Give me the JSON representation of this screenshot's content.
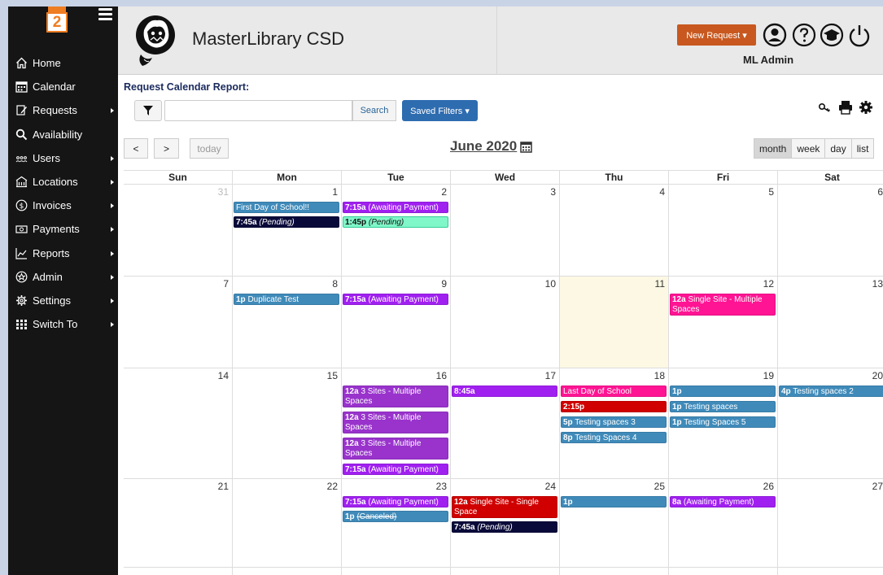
{
  "app": {
    "title": "MasterLibrary CSD",
    "new_request_label": "New Request ▾",
    "user_name": "ML Admin",
    "logo_text": "2"
  },
  "sidebar": {
    "items": [
      {
        "label": "Home",
        "icon": "home-icon",
        "arrow": false
      },
      {
        "label": "Calendar",
        "icon": "calendar-icon",
        "arrow": false
      },
      {
        "label": "Requests",
        "icon": "requests-icon",
        "arrow": true
      },
      {
        "label": "Availability",
        "icon": "search-icon",
        "arrow": false
      },
      {
        "label": "Users",
        "icon": "users-icon",
        "arrow": true
      },
      {
        "label": "Locations",
        "icon": "building-icon",
        "arrow": true
      },
      {
        "label": "Invoices",
        "icon": "dollar-icon",
        "arrow": true
      },
      {
        "label": "Payments",
        "icon": "money-icon",
        "arrow": true
      },
      {
        "label": "Reports",
        "icon": "chart-icon",
        "arrow": true
      },
      {
        "label": "Admin",
        "icon": "admin-icon",
        "arrow": true
      },
      {
        "label": "Settings",
        "icon": "gear-icon",
        "arrow": true
      },
      {
        "label": "Switch To",
        "icon": "grid-icon",
        "arrow": true
      }
    ]
  },
  "report": {
    "title": "Request Calendar Report:",
    "search_placeholder": "",
    "search_label": "Search",
    "saved_filters_label": "Saved Filters ▾"
  },
  "calendar": {
    "month_title": "June 2020",
    "today_label": "today",
    "prev_label": "<",
    "next_label": ">",
    "views": [
      "month",
      "week",
      "day",
      "list"
    ],
    "active_view": "month",
    "day_headers": [
      "Sun",
      "Mon",
      "Tue",
      "Wed",
      "Thu",
      "Fri",
      "Sat"
    ],
    "weeks": [
      {
        "days": [
          {
            "num": "31",
            "other": true,
            "events": []
          },
          {
            "num": "1",
            "events": [
              {
                "time": "",
                "text": "First Day of School!!",
                "color": "blue"
              },
              {
                "time": "7:45a",
                "text": "(Pending)",
                "style": "italic",
                "color": "navy"
              }
            ]
          },
          {
            "num": "2",
            "events": [
              {
                "time": "7:15a",
                "text": "(Awaiting Payment)",
                "color": "purple"
              },
              {
                "time": "1:45p",
                "text": "(Pending)",
                "style": "italic",
                "color": "mint"
              }
            ]
          },
          {
            "num": "3",
            "events": []
          },
          {
            "num": "4",
            "events": []
          },
          {
            "num": "5",
            "events": []
          },
          {
            "num": "6",
            "events": []
          }
        ]
      },
      {
        "days": [
          {
            "num": "7",
            "events": []
          },
          {
            "num": "8",
            "events": [
              {
                "time": "1p",
                "text": "Duplicate Test",
                "color": "blue"
              }
            ]
          },
          {
            "num": "9",
            "events": [
              {
                "time": "7:15a",
                "text": "(Awaiting Payment)",
                "color": "purple"
              }
            ]
          },
          {
            "num": "10",
            "events": []
          },
          {
            "num": "11",
            "today": true,
            "events": []
          },
          {
            "num": "12",
            "events": [
              {
                "time": "12a",
                "text": "Single Site - Multiple Spaces",
                "color": "pink",
                "wrap": true
              }
            ]
          },
          {
            "num": "13",
            "events": []
          }
        ]
      },
      {
        "days": [
          {
            "num": "14",
            "events": []
          },
          {
            "num": "15",
            "events": []
          },
          {
            "num": "16",
            "events": [
              {
                "time": "12a",
                "text": "3 Sites - Multiple Spaces",
                "color": "violet",
                "wrap": true
              },
              {
                "time": "12a",
                "text": "3 Sites - Multiple Spaces",
                "color": "violet",
                "wrap": true
              },
              {
                "time": "12a",
                "text": "3 Sites - Multiple Spaces",
                "color": "violet",
                "wrap": true
              },
              {
                "time": "7:15a",
                "text": "(Awaiting Payment)",
                "color": "purple"
              }
            ]
          },
          {
            "num": "17",
            "events": [
              {
                "time": "8:45a",
                "text": "",
                "color": "purple"
              }
            ]
          },
          {
            "num": "18",
            "events": [
              {
                "time": "",
                "text": "Last Day of School",
                "color": "pink"
              },
              {
                "time": "2:15p",
                "text": "",
                "color": "red"
              },
              {
                "time": "5p",
                "text": "Testing spaces 3",
                "color": "blue"
              },
              {
                "time": "8p",
                "text": "Testing Spaces 4",
                "color": "blue"
              }
            ]
          },
          {
            "num": "19",
            "events": [
              {
                "time": "1p",
                "text": "",
                "color": "blue"
              },
              {
                "time": "1p",
                "text": "Testing spaces",
                "color": "blue"
              },
              {
                "time": "1p",
                "text": "Testing Spaces 5",
                "color": "blue"
              }
            ]
          },
          {
            "num": "20",
            "events": [
              {
                "time": "4p",
                "text": "Testing spaces 2",
                "color": "blue"
              }
            ]
          }
        ]
      },
      {
        "days": [
          {
            "num": "21",
            "events": []
          },
          {
            "num": "22",
            "events": []
          },
          {
            "num": "23",
            "events": [
              {
                "time": "7:15a",
                "text": "(Awaiting Payment)",
                "color": "purple"
              },
              {
                "time": "1p",
                "text": "(Canceled)",
                "style": "strike",
                "color": "blue"
              }
            ]
          },
          {
            "num": "24",
            "events": [
              {
                "time": "12a",
                "text": "Single Site - Single Space",
                "color": "red",
                "wrap": true
              },
              {
                "time": "7:45a",
                "text": "(Pending)",
                "style": "italic",
                "color": "navy"
              }
            ]
          },
          {
            "num": "25",
            "events": [
              {
                "time": "1p",
                "text": "",
                "color": "blue"
              }
            ]
          },
          {
            "num": "26",
            "events": [
              {
                "time": "8a",
                "text": "(Awaiting Payment)",
                "color": "purple"
              }
            ]
          },
          {
            "num": "27",
            "events": []
          }
        ]
      }
    ]
  }
}
